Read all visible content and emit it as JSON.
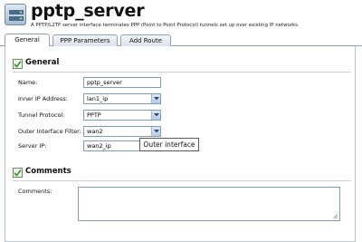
{
  "header": {
    "title": "pptp_server",
    "subtitle": "A PPTP/L2TP server interface terminates PPP (Point to Point Protocol) tunnels set up over existing IP networks.",
    "icon": "server-interface-icon"
  },
  "tabs": [
    {
      "label": "General",
      "active": true
    },
    {
      "label": "PPP Parameters",
      "active": false
    },
    {
      "label": "Add Route",
      "active": false
    }
  ],
  "general": {
    "heading": "General",
    "fields": {
      "name": {
        "label": "Name:",
        "value": "pptp_server"
      },
      "inner_ip": {
        "label": "Inner IP Address:",
        "value": "lan1_ip"
      },
      "tunnel_protocol": {
        "label": "Tunnel Protocol:",
        "value": "PPTP"
      },
      "outer_filter": {
        "label": "Outer Interface Filter:",
        "value": "wan2"
      },
      "server_ip": {
        "label": "Server IP:",
        "value": "wan2_ip"
      }
    },
    "tooltip": "Outer interface"
  },
  "comments": {
    "heading": "Comments",
    "label": "Comments:",
    "value": ""
  },
  "colors": {
    "tab_border": "#8fa3b7",
    "field_border": "#7f9db9",
    "section_icon_green": "#3c8f2f"
  }
}
